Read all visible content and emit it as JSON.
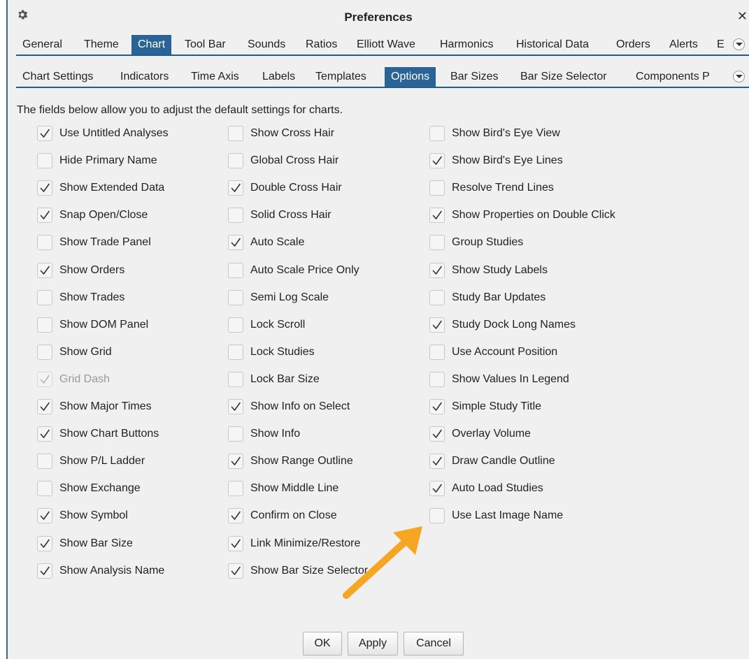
{
  "window": {
    "title": "Preferences"
  },
  "main_tabs": [
    {
      "label": "General",
      "active": false
    },
    {
      "label": "Theme",
      "active": false
    },
    {
      "label": "Chart",
      "active": true
    },
    {
      "label": "Tool Bar",
      "active": false
    },
    {
      "label": "Sounds",
      "active": false
    },
    {
      "label": "Ratios",
      "active": false
    },
    {
      "label": "Elliott Wave",
      "active": false
    },
    {
      "label": "Harmonics",
      "active": false
    },
    {
      "label": "Historical Data",
      "active": false
    },
    {
      "label": "Orders",
      "active": false
    },
    {
      "label": "Alerts",
      "active": false
    },
    {
      "label": "E",
      "active": false
    }
  ],
  "sub_tabs": [
    {
      "label": "Chart Settings",
      "active": false
    },
    {
      "label": "Indicators",
      "active": false
    },
    {
      "label": "Time Axis",
      "active": false
    },
    {
      "label": "Labels",
      "active": false
    },
    {
      "label": "Templates",
      "active": false
    },
    {
      "label": "Options",
      "active": true
    },
    {
      "label": "Bar Sizes",
      "active": false
    },
    {
      "label": "Bar Size Selector",
      "active": false
    },
    {
      "label": "Components P",
      "active": false
    }
  ],
  "description": "The fields below allow you to adjust the default settings for charts.",
  "options": {
    "column1": [
      {
        "label": "Use Untitled Analyses",
        "checked": true
      },
      {
        "label": "Hide Primary Name",
        "checked": false
      },
      {
        "label": "Show Extended Data",
        "checked": true
      },
      {
        "label": "Snap Open/Close",
        "checked": true
      },
      {
        "label": "Show Trade Panel",
        "checked": false
      },
      {
        "label": "Show Orders",
        "checked": true
      },
      {
        "label": "Show Trades",
        "checked": false
      },
      {
        "label": "Show DOM Panel",
        "checked": false
      },
      {
        "label": "Show Grid",
        "checked": false
      },
      {
        "label": "Grid Dash",
        "checked": true,
        "disabled": true
      },
      {
        "label": "Show Major Times",
        "checked": true
      },
      {
        "label": "Show Chart Buttons",
        "checked": true
      },
      {
        "label": "Show P/L Ladder",
        "checked": false
      },
      {
        "label": "Show Exchange",
        "checked": false
      },
      {
        "label": "Show Symbol",
        "checked": true
      },
      {
        "label": "Show Bar Size",
        "checked": true
      },
      {
        "label": "Show Analysis Name",
        "checked": true
      }
    ],
    "column2": [
      {
        "label": "Show Cross Hair",
        "checked": false
      },
      {
        "label": "Global Cross Hair",
        "checked": false
      },
      {
        "label": "Double Cross Hair",
        "checked": true
      },
      {
        "label": "Solid Cross Hair",
        "checked": false
      },
      {
        "label": "Auto Scale",
        "checked": true
      },
      {
        "label": "Auto Scale Price Only",
        "checked": false
      },
      {
        "label": "Semi Log Scale",
        "checked": false
      },
      {
        "label": "Lock Scroll",
        "checked": false
      },
      {
        "label": "Lock Studies",
        "checked": false
      },
      {
        "label": "Lock Bar Size",
        "checked": false
      },
      {
        "label": "Show Info on Select",
        "checked": true
      },
      {
        "label": "Show Info",
        "checked": false
      },
      {
        "label": "Show Range Outline",
        "checked": true
      },
      {
        "label": "Show Middle Line",
        "checked": false
      },
      {
        "label": "Confirm on Close",
        "checked": true
      },
      {
        "label": "Link Minimize/Restore",
        "checked": true
      },
      {
        "label": "Show Bar Size Selector",
        "checked": true
      }
    ],
    "column3": [
      {
        "label": "Show Bird's Eye View",
        "checked": false
      },
      {
        "label": "Show Bird's Eye Lines",
        "checked": true
      },
      {
        "label": "Resolve Trend Lines",
        "checked": false
      },
      {
        "label": "Show Properties on Double Click",
        "checked": true
      },
      {
        "label": "Group Studies",
        "checked": false
      },
      {
        "label": "Show Study Labels",
        "checked": true
      },
      {
        "label": "Study Bar Updates",
        "checked": false
      },
      {
        "label": "Study Dock Long Names",
        "checked": true
      },
      {
        "label": "Use Account Position",
        "checked": false
      },
      {
        "label": "Show Values In Legend",
        "checked": false
      },
      {
        "label": "Simple Study Title",
        "checked": true
      },
      {
        "label": "Overlay Volume",
        "checked": true
      },
      {
        "label": "Draw Candle Outline",
        "checked": true
      },
      {
        "label": "Auto Load Studies",
        "checked": true
      },
      {
        "label": "Use Last Image Name",
        "checked": false
      }
    ]
  },
  "buttons": {
    "ok": "OK",
    "apply": "Apply",
    "cancel": "Cancel"
  },
  "icons": {
    "settings": "gear-icon",
    "close": "close-icon",
    "more_tabs": "chevron-down-icon",
    "callout": "arrow-icon"
  },
  "colors": {
    "accent": "#2a6496",
    "tab_underline": "#1f5e8b",
    "callout_arrow": "#f5a623"
  }
}
